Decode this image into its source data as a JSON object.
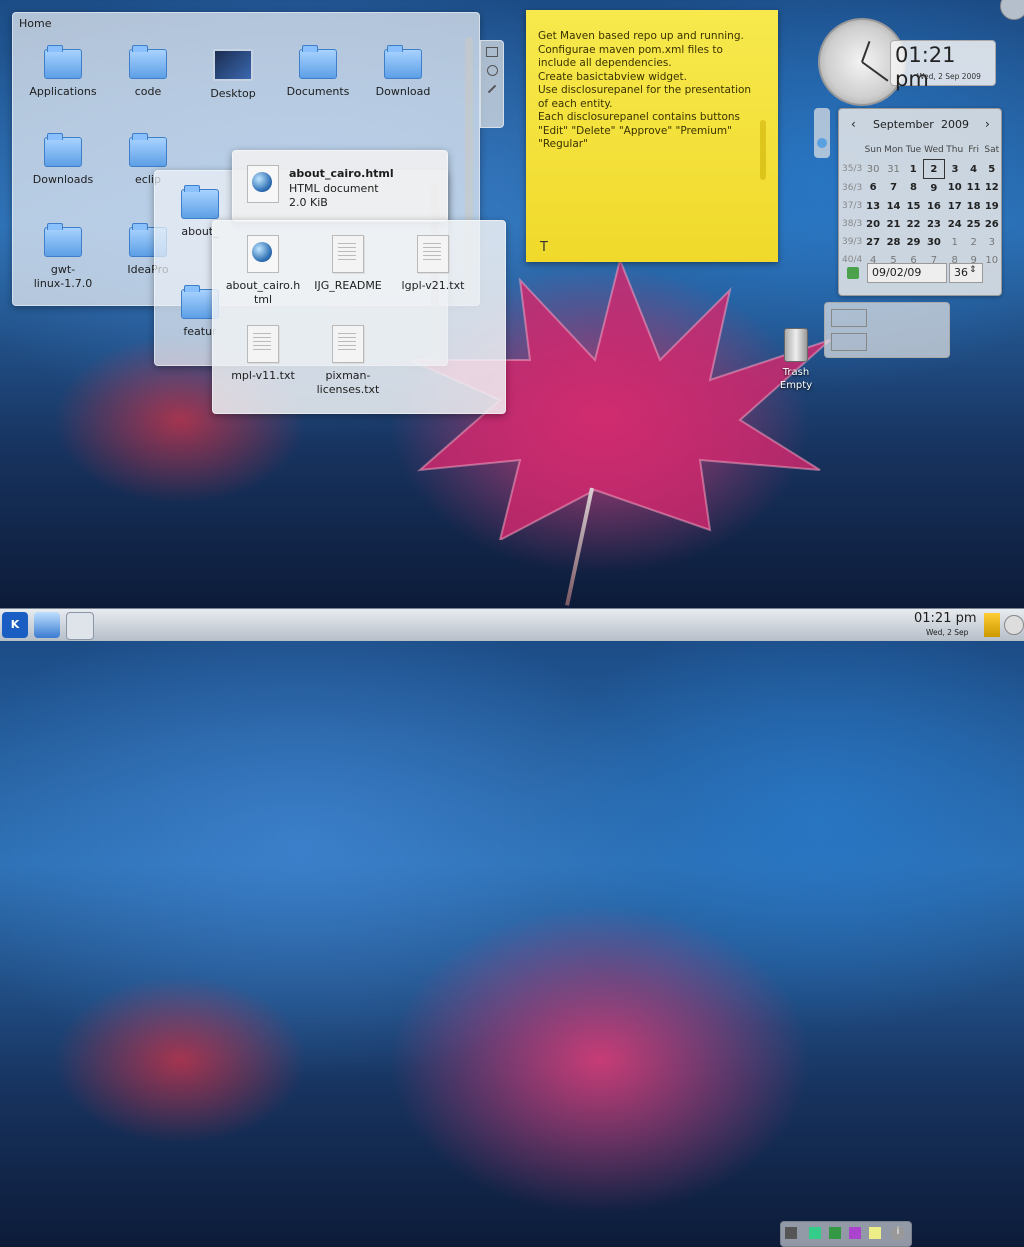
{
  "home_view": {
    "title": "Home",
    "items": [
      {
        "label": "Applications",
        "icon": "folder-icon"
      },
      {
        "label": "code",
        "icon": "folder-icon"
      },
      {
        "label": "Desktop",
        "icon": "desktop-icon"
      },
      {
        "label": "Documents",
        "icon": "folder-icon"
      },
      {
        "label": "Download",
        "icon": "folder-icon"
      },
      {
        "label": "Downloads",
        "icon": "folder-icon"
      },
      {
        "label": "eclip",
        "icon": "folder-icon"
      },
      {
        "label": "gwt-\nlinux-1.7.0",
        "icon": "folder-icon"
      },
      {
        "label": "IdeaPro",
        "icon": "folder-icon"
      }
    ]
  },
  "mid_view": {
    "items": [
      {
        "label": "about_",
        "icon": "folder-icon"
      },
      {
        "label": "featur",
        "icon": "folder-icon"
      }
    ]
  },
  "tooltip": {
    "name": "about_cairo.html",
    "type": "HTML document",
    "size": "2.0 KiB"
  },
  "front_view": {
    "items": [
      {
        "label": "about_cairo.h\ntml",
        "icon": "html-file-icon"
      },
      {
        "label": "IJG_README",
        "icon": "text-file-icon"
      },
      {
        "label": "lgpl-v21.txt",
        "icon": "text-file-icon"
      },
      {
        "label": "mpl-v11.txt",
        "icon": "text-file-icon"
      },
      {
        "label": "pixman-\nlicenses.txt",
        "icon": "text-file-icon"
      }
    ]
  },
  "note": {
    "text": "Get Maven based repo up and running.\nConfigurae maven pom.xml files to include all dependencies.\nCreate basictabview widget.\nUse disclosurepanel for the presentation of each entity.\nEach disclosurepanel contains buttons \"Edit\" \"Delete\" \"Approve\" \"Premium\" \"Regular\""
  },
  "clock_widget": {
    "time": "01:21 pm",
    "date": "Wed, 2 Sep 2009"
  },
  "calendar": {
    "month": "September",
    "year": "2009",
    "headers": [
      "Sun",
      "Mon",
      "Tue",
      "Wed",
      "Thu",
      "Fri",
      "Sat"
    ],
    "weeks": [
      {
        "wk": "35/3",
        "days": [
          "30",
          "31",
          "1",
          "2",
          "3",
          "4",
          "5"
        ]
      },
      {
        "wk": "36/3",
        "days": [
          "6",
          "7",
          "8",
          "9",
          "10",
          "11",
          "12"
        ]
      },
      {
        "wk": "37/3",
        "days": [
          "13",
          "14",
          "15",
          "16",
          "17",
          "18",
          "19"
        ]
      },
      {
        "wk": "38/3",
        "days": [
          "20",
          "21",
          "22",
          "23",
          "24",
          "25",
          "26"
        ]
      },
      {
        "wk": "39/3",
        "days": [
          "27",
          "28",
          "29",
          "30",
          "1",
          "2",
          "3"
        ]
      },
      {
        "wk": "40/4",
        "days": [
          "4",
          "5",
          "6",
          "7",
          "8",
          "9",
          "10"
        ]
      }
    ],
    "date_field": "09/02/09",
    "week_field": "36"
  },
  "trash": {
    "label": "Trash\nEmpty"
  },
  "taskbar": {
    "time": "01:21 pm",
    "date": "Wed, 2 Sep"
  },
  "colors": {
    "note": "#f2dc33",
    "accent": "#3f7fc9"
  }
}
